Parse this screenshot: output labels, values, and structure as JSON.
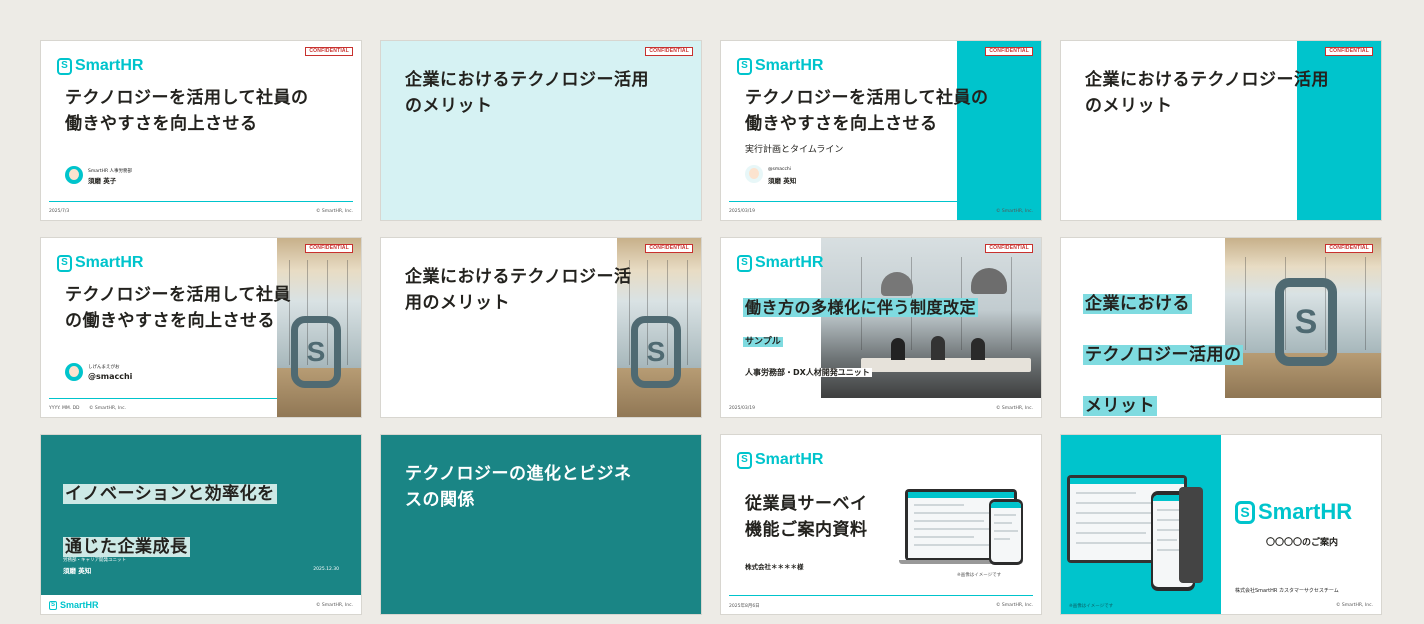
{
  "brand": {
    "logo_text": "SmartHR",
    "accent": "#00c4cc",
    "teal_dark": "#1a8585",
    "confidential": "CONFIDENTIAL",
    "copyright": "© SmartHR, Inc."
  },
  "slides": [
    {
      "title": "テクノロジーを活用して社員の\n働きやすさを向上させる",
      "dept": "SmartHR 人事労務部",
      "name": "須磨 英子",
      "date": "2025/7/3"
    },
    {
      "title": "企業におけるテクノロジー活用\nのメリット"
    },
    {
      "title": "テクノロジーを活用して社員の\n働きやすさを向上させる",
      "subtitle": "実行計画とタイムライン",
      "handle": "@smacchi",
      "name": "須磨 英知",
      "date": "2025/03/19"
    },
    {
      "title": "企業におけるテクノロジー活用\nのメリット"
    },
    {
      "title": "テクノロジーを活用して社員\nの働きやすさを向上させる",
      "handle_label": "しげんまえがお",
      "handle": "@smacchi",
      "date": "YYYY. MM. DD"
    },
    {
      "title": "企業におけるテクノロジー活\n用のメリット"
    },
    {
      "title": "働き方の多様化に伴う制度改定",
      "subtitle": "サンプル",
      "dept": "人事労務部・DX人材開発ユニット",
      "date": "2025/03/19"
    },
    {
      "title_lines": [
        "企業における",
        "テクノロジー活用の",
        "メリット"
      ]
    },
    {
      "title_lines": [
        "イノベーションと効率化を",
        "通じた企業成長"
      ],
      "dept": "労務部・キャリア開発ユニット",
      "name": "須磨 英知",
      "date": "2025.12.30"
    },
    {
      "title": "テクノロジーの進化とビジネ\nスの関係"
    },
    {
      "title": "従業員サーベイ\n機能ご案内資料",
      "client": "株式会社＊＊＊＊様",
      "note": "※画像はイメージです",
      "date": "2025年8月6日"
    },
    {
      "subtitle": "〇〇〇〇のご案内",
      "team": "株式会社SmartHR カスタマーサクセスチーム",
      "note": "※画像はイメージです"
    }
  ]
}
